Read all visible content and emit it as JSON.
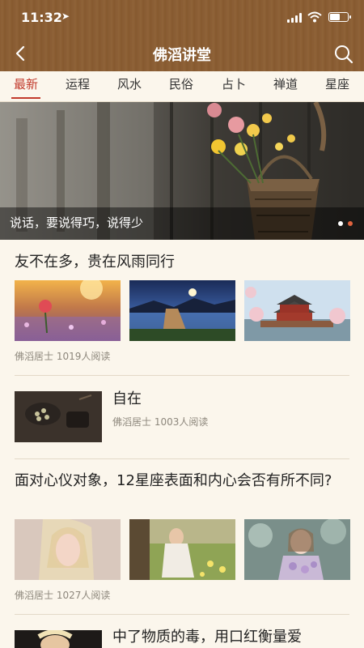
{
  "status": {
    "time": "11:32"
  },
  "nav": {
    "title": "佛滔讲堂"
  },
  "tabs": [
    "最新",
    "运程",
    "风水",
    "民俗",
    "占卜",
    "禅道",
    "星座"
  ],
  "banner": {
    "caption": "说话，要说得巧，说得少"
  },
  "articles": [
    {
      "title": "友不在多，贵在风雨同行",
      "meta": "佛滔居士  1019人阅读"
    },
    {
      "title": "自在",
      "meta": "佛滔居士  1003人阅读"
    },
    {
      "title": "面对心仪对象，12星座表面和内心会否有所不同?",
      "meta": "佛滔居士  1027人阅读"
    },
    {
      "title": "中了物质的毒，用口红衡量爱"
    }
  ],
  "colors": {
    "header": "#8a5d34",
    "accent": "#c23a2c",
    "background": "#fbf6ec"
  },
  "icons": {
    "back": "chevron-left-icon",
    "search": "search-icon"
  }
}
